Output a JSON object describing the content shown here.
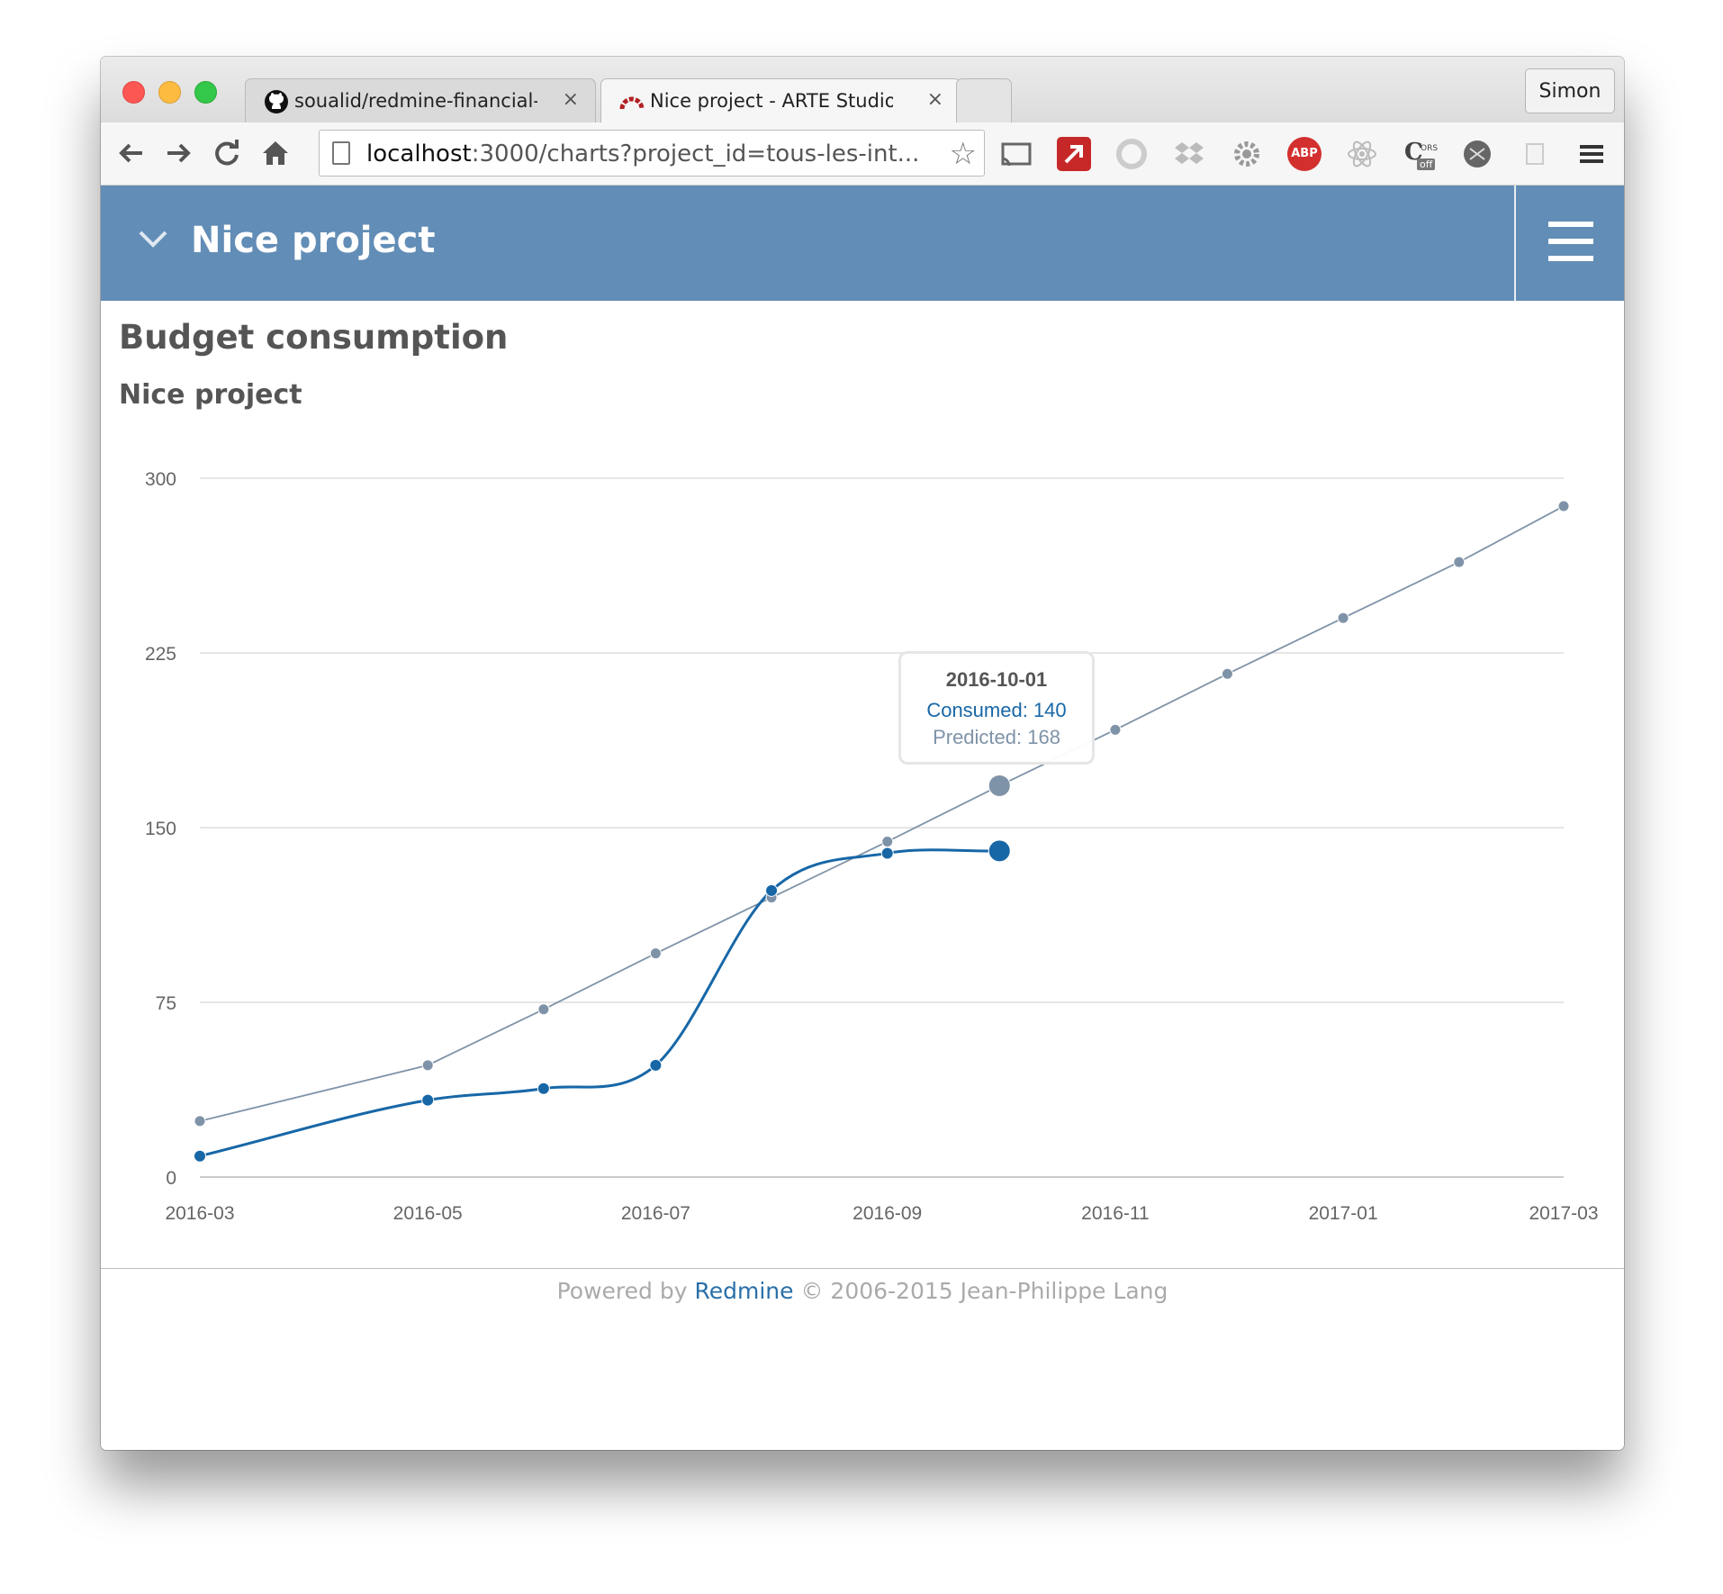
{
  "browser": {
    "tabs": [
      {
        "label": "soualid/redmine-financial-m",
        "active": false,
        "icon": "github-icon"
      },
      {
        "label": "Nice project - ARTE Studio",
        "active": true,
        "icon": "redmine-icon"
      }
    ],
    "close_glyph": "×",
    "profile_name": "Simon",
    "url_host": "localhost",
    "url_rest": ":3000/charts?project_id=tous-les-int...",
    "extensions": [
      "cast-icon",
      "red-arrow-extension-icon",
      "sync-icon",
      "dropbox-icon",
      "gear-extension-icon",
      "adblock-plus-icon",
      "react-devtools-icon",
      "cors-extension-icon",
      "ghost-extension-icon",
      "note-extension-icon"
    ],
    "abp_label": "ABP",
    "cors_label": "C",
    "cors_sub": "ORS",
    "cors_off": "off"
  },
  "header": {
    "project_title": "Nice project"
  },
  "page": {
    "title": "Budget consumption",
    "subtitle": "Nice project"
  },
  "chart_data": {
    "type": "line",
    "x_ticks": [
      "2016-03",
      "2016-05",
      "2016-07",
      "2016-09",
      "2016-11",
      "2017-01",
      "2017-03"
    ],
    "y_ticks": [
      "0",
      "75",
      "150",
      "225",
      "300"
    ],
    "ylim": [
      0,
      300
    ],
    "xlim": [
      "2016-03-01",
      "2017-03-01"
    ],
    "grid": true,
    "series": [
      {
        "name": "Consumed",
        "color": "#1767a7",
        "x": [
          "2016-03-01",
          "2016-05-01",
          "2016-06-01",
          "2016-07-01",
          "2016-08-01",
          "2016-09-01",
          "2016-10-01"
        ],
        "y": [
          9,
          33,
          38,
          48,
          123,
          139,
          140
        ]
      },
      {
        "name": "Predicted",
        "color": "#7f93a8",
        "x": [
          "2016-03-01",
          "2016-05-01",
          "2016-06-01",
          "2016-07-01",
          "2016-08-01",
          "2016-09-01",
          "2016-10-01",
          "2016-11-01",
          "2016-12-01",
          "2017-01-01",
          "2017-02-01",
          "2017-03-01"
        ],
        "y": [
          24,
          48,
          72,
          96,
          120,
          144,
          168,
          192,
          216,
          240,
          264,
          288
        ]
      }
    ],
    "tooltip": {
      "date": "2016-10-01",
      "consumed": "Consumed: 140",
      "predicted": "Predicted: 168"
    }
  },
  "footer": {
    "prefix": "Powered by ",
    "link": "Redmine",
    "suffix": " © 2006-2015 Jean-Philippe Lang"
  }
}
